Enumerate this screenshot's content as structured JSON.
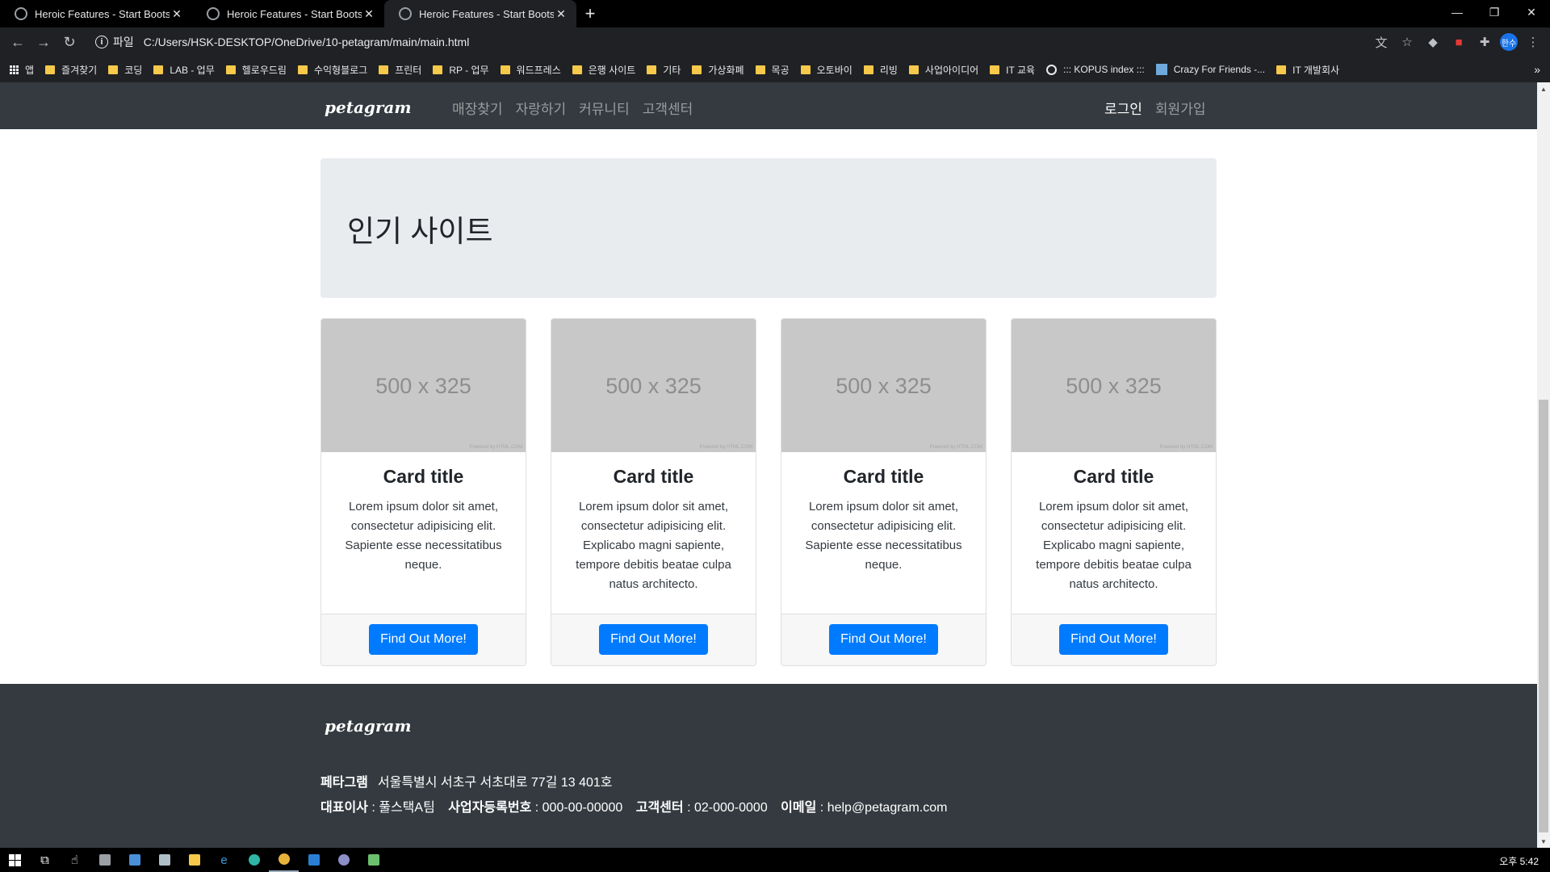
{
  "browser": {
    "tabs": [
      {
        "title": "Heroic Features - Start Bootstrap",
        "active": false
      },
      {
        "title": "Heroic Features - Start Bootstrap",
        "active": false
      },
      {
        "title": "Heroic Features - Start Bootstrap",
        "active": true
      }
    ],
    "new_tab": "+",
    "window_controls": {
      "minimize": "—",
      "restore": "❐",
      "close": "✕"
    },
    "nav": {
      "back": "←",
      "forward": "→",
      "reload": "↻"
    },
    "address": {
      "info": "i",
      "scheme": "파일",
      "url": "C:/Users/HSK-DESKTOP/OneDrive/10-petagram/main/main.html"
    },
    "profile": "한수",
    "bookmarks": [
      "앱",
      "즐겨찾기",
      "코딩",
      "LAB - 업무",
      "헬로우드림",
      "수익형블로그",
      "프린터",
      "RP - 업무",
      "워드프레스",
      "은행 사이트",
      "기타",
      "가상화폐",
      "목공",
      "오토바이",
      "리빙",
      "사업아이디어",
      "IT 교육",
      "::: KOPUS index :::",
      "Crazy For Friends -...",
      "IT 개발회사"
    ],
    "bookmarks_more": "»"
  },
  "navbar": {
    "brand": "petagram",
    "links": [
      "매장찾기",
      "자랑하기",
      "커뮤니티",
      "고객센터"
    ],
    "login": "로그인",
    "signup": "회원가입"
  },
  "jumbotron": {
    "title": "인기 사이트"
  },
  "cards": [
    {
      "image_label": "500 x 325",
      "image_credit": "Powered by HTML.COM",
      "title": "Card title",
      "text": "Lorem ipsum dolor sit amet, consectetur adipisicing elit. Sapiente esse necessitatibus neque.",
      "button": "Find Out More!"
    },
    {
      "image_label": "500 x 325",
      "image_credit": "Powered by HTML.COM",
      "title": "Card title",
      "text": "Lorem ipsum dolor sit amet, consectetur adipisicing elit. Explicabo magni sapiente, tempore debitis beatae culpa natus architecto.",
      "button": "Find Out More!"
    },
    {
      "image_label": "500 x 325",
      "image_credit": "Powered by HTML.COM",
      "title": "Card title",
      "text": "Lorem ipsum dolor sit amet, consectetur adipisicing elit. Sapiente esse necessitatibus neque.",
      "button": "Find Out More!"
    },
    {
      "image_label": "500 x 325",
      "image_credit": "Powered by HTML.COM",
      "title": "Card title",
      "text": "Lorem ipsum dolor sit amet, consectetur adipisicing elit. Explicabo magni sapiente, tempore debitis beatae culpa natus architecto.",
      "button": "Find Out More!"
    }
  ],
  "footer": {
    "brand": "petagram",
    "company_label": "페타그램",
    "address": "서울특별시 서초구 서초대로 77길 13 401호",
    "ceo_label": "대표이사",
    "ceo_value": ": 풀스택A팀",
    "biz_label": "사업자등록번호",
    "biz_value": ": 000-00-00000",
    "cs_label": "고객센터",
    "cs_value": ": 02-000-0000",
    "email_label": "이메일",
    "email_value": ": help@petagram.com"
  },
  "taskbar": {
    "clock": "오후 5:42"
  },
  "colors": {
    "navbar": "#343a40",
    "jumbotron": "#e9ecef",
    "primary_button": "#007bff",
    "placeholder": "#c8c8c8"
  }
}
